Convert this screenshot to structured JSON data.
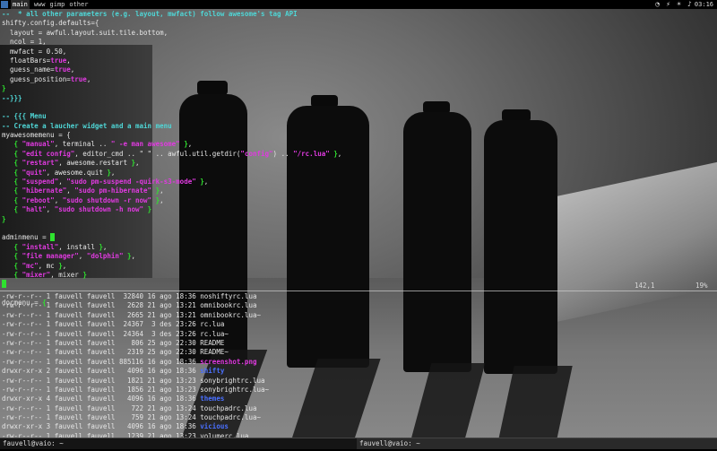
{
  "topbar": {
    "tags": [
      {
        "label": "main",
        "active": true
      },
      {
        "label": "www",
        "active": false
      },
      {
        "label": "gimp",
        "active": false
      },
      {
        "label": "other",
        "active": false
      }
    ],
    "tray_icons": [
      "wifi-icon",
      "power-icon",
      "brightness-icon",
      "volume-icon"
    ],
    "clock": "03:16"
  },
  "editor": {
    "lines": [
      [
        [
          "c-comment",
          "--  * all other parameters (e.g. layout, mwfact) follow awesome's tag API"
        ]
      ],
      [
        [
          "c-plain",
          "shifty.config.defaults={"
        ]
      ],
      [
        [
          "c-plain",
          "  layout = awful.layout.suit.tile.bottom,"
        ]
      ],
      [
        [
          "c-plain",
          "  ncol = 1,"
        ]
      ],
      [
        [
          "c-plain",
          "  mwfact = 0.50,"
        ]
      ],
      [
        [
          "c-plain",
          "  floatBars="
        ],
        [
          "c-bool",
          "true"
        ],
        [
          "c-plain",
          ","
        ]
      ],
      [
        [
          "c-plain",
          "  guess_name="
        ],
        [
          "c-bool",
          "true"
        ],
        [
          "c-plain",
          ","
        ]
      ],
      [
        [
          "c-plain",
          "  guess_position="
        ],
        [
          "c-bool",
          "true"
        ],
        [
          "c-plain",
          ","
        ]
      ],
      [
        [
          "c-brace",
          "}"
        ]
      ],
      [
        [
          "c-comment",
          "--}}}"
        ]
      ],
      [
        [
          "c-plain",
          ""
        ]
      ],
      [
        [
          "c-comment",
          "-- {{{ Menu"
        ]
      ],
      [
        [
          "c-comment",
          "-- Create a laucher widget and a main menu"
        ]
      ],
      [
        [
          "c-plain",
          "myawesomemenu = {"
        ]
      ],
      [
        [
          "c-plain",
          "   "
        ],
        [
          "c-brace",
          "{"
        ],
        [
          "c-str",
          " \"manual\""
        ],
        [
          "c-plain",
          ", terminal .. "
        ],
        [
          "c-str",
          "\" -e man awesome\""
        ],
        [
          "c-plain",
          " "
        ],
        [
          "c-brace",
          "}"
        ],
        [
          "c-plain",
          ","
        ]
      ],
      [
        [
          "c-plain",
          "   "
        ],
        [
          "c-brace",
          "{"
        ],
        [
          "c-str",
          " \"edit config\""
        ],
        [
          "c-plain",
          ", editor_cmd .. \" \" .. awful.util.getdir("
        ],
        [
          "c-str",
          "\"config\""
        ],
        [
          "c-plain",
          ") .. "
        ],
        [
          "c-str",
          "\"/rc.lua\""
        ],
        [
          "c-plain",
          " "
        ],
        [
          "c-brace",
          "}"
        ],
        [
          "c-plain",
          ","
        ]
      ],
      [
        [
          "c-plain",
          "   "
        ],
        [
          "c-brace",
          "{"
        ],
        [
          "c-str",
          " \"restart\""
        ],
        [
          "c-plain",
          ", awesome.restart "
        ],
        [
          "c-brace",
          "}"
        ],
        [
          "c-plain",
          ","
        ]
      ],
      [
        [
          "c-plain",
          "   "
        ],
        [
          "c-brace",
          "{"
        ],
        [
          "c-str",
          " \"quit\""
        ],
        [
          "c-plain",
          ", awesome.quit "
        ],
        [
          "c-brace",
          "}"
        ],
        [
          "c-plain",
          ","
        ]
      ],
      [
        [
          "c-plain",
          "   "
        ],
        [
          "c-brace",
          "{"
        ],
        [
          "c-str",
          " \"suspend\""
        ],
        [
          "c-plain",
          ", "
        ],
        [
          "c-str",
          "\"sudo pm-suspend -quirk-s3-mode\""
        ],
        [
          "c-plain",
          " "
        ],
        [
          "c-brace",
          "}"
        ],
        [
          "c-plain",
          ","
        ]
      ],
      [
        [
          "c-plain",
          "   "
        ],
        [
          "c-brace",
          "{"
        ],
        [
          "c-str",
          " \"hibernate\""
        ],
        [
          "c-plain",
          ", "
        ],
        [
          "c-str",
          "\"sudo pm-hibernate\""
        ],
        [
          "c-plain",
          " "
        ],
        [
          "c-brace",
          "}"
        ],
        [
          "c-plain",
          ","
        ]
      ],
      [
        [
          "c-plain",
          "   "
        ],
        [
          "c-brace",
          "{"
        ],
        [
          "c-str",
          " \"reboot\""
        ],
        [
          "c-plain",
          ", "
        ],
        [
          "c-str",
          "\"sudo shutdown -r now\""
        ],
        [
          "c-plain",
          " "
        ],
        [
          "c-brace",
          "}"
        ],
        [
          "c-plain",
          ","
        ]
      ],
      [
        [
          "c-plain",
          "   "
        ],
        [
          "c-brace",
          "{"
        ],
        [
          "c-str",
          " \"halt\""
        ],
        [
          "c-plain",
          ", "
        ],
        [
          "c-str",
          "\"sudo shutdown -h now\""
        ],
        [
          "c-plain",
          " "
        ],
        [
          "c-brace",
          "}"
        ]
      ],
      [
        [
          "c-brace",
          "}"
        ]
      ],
      [
        [
          "c-plain",
          ""
        ]
      ],
      [
        [
          "c-plain",
          "adminmenu = "
        ],
        [
          "c-cur",
          "{"
        ]
      ],
      [
        [
          "c-plain",
          "   "
        ],
        [
          "c-brace",
          "{"
        ],
        [
          "c-str",
          " \"install\""
        ],
        [
          "c-plain",
          ", install "
        ],
        [
          "c-brace",
          "}"
        ],
        [
          "c-plain",
          ","
        ]
      ],
      [
        [
          "c-plain",
          "   "
        ],
        [
          "c-brace",
          "{"
        ],
        [
          "c-str",
          " \"file manager\""
        ],
        [
          "c-plain",
          ", "
        ],
        [
          "c-str",
          "\"dolphin\""
        ],
        [
          "c-plain",
          " "
        ],
        [
          "c-brace",
          "}"
        ],
        [
          "c-plain",
          ","
        ]
      ],
      [
        [
          "c-plain",
          "   "
        ],
        [
          "c-brace",
          "{"
        ],
        [
          "c-str",
          " \"mc\""
        ],
        [
          "c-plain",
          ", mc "
        ],
        [
          "c-brace",
          "}"
        ],
        [
          "c-plain",
          ","
        ]
      ],
      [
        [
          "c-plain",
          "   "
        ],
        [
          "c-brace",
          "{"
        ],
        [
          "c-str",
          " \"mixer\""
        ],
        [
          "c-plain",
          ", mixer "
        ],
        [
          "c-brace",
          "}"
        ]
      ],
      [
        [
          "c-cur",
          "}"
        ]
      ],
      [
        [
          "c-plain",
          ""
        ]
      ],
      [
        [
          "c-plain",
          "docmenu = "
        ],
        [
          "c-brace",
          "{"
        ]
      ]
    ],
    "status_position": "142,1",
    "status_percent": "19%"
  },
  "listing": {
    "rows": [
      {
        "perm": "-rw-r--r--",
        "links": "1",
        "owner": "fauvell",
        "group": "fauvell",
        "size": "32840",
        "day": "16",
        "month": "ago",
        "time": "18:36",
        "name": "noshiftyrc.lua",
        "kind": "file"
      },
      {
        "perm": "-rw-r--r--",
        "links": "1",
        "owner": "fauvell",
        "group": "fauvell",
        "size": "2628",
        "day": "21",
        "month": "ago",
        "time": "13:21",
        "name": "omnibookrc.lua",
        "kind": "file"
      },
      {
        "perm": "-rw-r--r--",
        "links": "1",
        "owner": "fauvell",
        "group": "fauvell",
        "size": "2665",
        "day": "21",
        "month": "ago",
        "time": "13:21",
        "name": "omnibookrc.lua~",
        "kind": "file"
      },
      {
        "perm": "-rw-r--r--",
        "links": "1",
        "owner": "fauvell",
        "group": "fauvell",
        "size": "24367",
        "day": "3",
        "month": "des",
        "time": "23:26",
        "name": "rc.lua",
        "kind": "file"
      },
      {
        "perm": "-rw-r--r--",
        "links": "1",
        "owner": "fauvell",
        "group": "fauvell",
        "size": "24364",
        "day": "3",
        "month": "des",
        "time": "23:26",
        "name": "rc.lua~",
        "kind": "file"
      },
      {
        "perm": "-rw-r--r--",
        "links": "1",
        "owner": "fauvell",
        "group": "fauvell",
        "size": "806",
        "day": "25",
        "month": "ago",
        "time": "22:30",
        "name": "README",
        "kind": "file"
      },
      {
        "perm": "-rw-r--r--",
        "links": "1",
        "owner": "fauvell",
        "group": "fauvell",
        "size": "2319",
        "day": "25",
        "month": "ago",
        "time": "22:30",
        "name": "README~",
        "kind": "file"
      },
      {
        "perm": "-rw-r--r--",
        "links": "1",
        "owner": "fauvell",
        "group": "fauvell",
        "size": "885116",
        "day": "16",
        "month": "ago",
        "time": "18:36",
        "name": "screenshot.png",
        "kind": "img"
      },
      {
        "perm": "drwxr-xr-x",
        "links": "2",
        "owner": "fauvell",
        "group": "fauvell",
        "size": "4096",
        "day": "16",
        "month": "ago",
        "time": "18:36",
        "name": "shifty",
        "kind": "dir"
      },
      {
        "perm": "-rw-r--r--",
        "links": "1",
        "owner": "fauvell",
        "group": "fauvell",
        "size": "1821",
        "day": "21",
        "month": "ago",
        "time": "13:23",
        "name": "sonybrightrc.lua",
        "kind": "file"
      },
      {
        "perm": "-rw-r--r--",
        "links": "1",
        "owner": "fauvell",
        "group": "fauvell",
        "size": "1856",
        "day": "21",
        "month": "ago",
        "time": "13:23",
        "name": "sonybrightrc.lua~",
        "kind": "file"
      },
      {
        "perm": "drwxr-xr-x",
        "links": "4",
        "owner": "fauvell",
        "group": "fauvell",
        "size": "4096",
        "day": "16",
        "month": "ago",
        "time": "18:36",
        "name": "themes",
        "kind": "dir"
      },
      {
        "perm": "-rw-r--r--",
        "links": "1",
        "owner": "fauvell",
        "group": "fauvell",
        "size": "722",
        "day": "21",
        "month": "ago",
        "time": "13:24",
        "name": "touchpadrc.lua",
        "kind": "file"
      },
      {
        "perm": "-rw-r--r--",
        "links": "1",
        "owner": "fauvell",
        "group": "fauvell",
        "size": "759",
        "day": "21",
        "month": "ago",
        "time": "13:24",
        "name": "touchpadrc.lua~",
        "kind": "file"
      },
      {
        "perm": "drwxr-xr-x",
        "links": "3",
        "owner": "fauvell",
        "group": "fauvell",
        "size": "4096",
        "day": "16",
        "month": "ago",
        "time": "18:36",
        "name": "vicious",
        "kind": "dir"
      },
      {
        "perm": "-rw-r--r--",
        "links": "1",
        "owner": "fauvell",
        "group": "fauvell",
        "size": "1239",
        "day": "21",
        "month": "ago",
        "time": "13:23",
        "name": "volumerc.lua",
        "kind": "file"
      },
      {
        "perm": "-rw-r--r--",
        "links": "1",
        "owner": "fauvell",
        "group": "fauvell",
        "size": "1278",
        "day": "21",
        "month": "ago",
        "time": "13:23",
        "name": "volumerc.lua~",
        "kind": "file"
      }
    ]
  },
  "taskbar": {
    "tasks": [
      "fauvell@vaio: ~",
      "fauvell@vaio: ~"
    ],
    "active_index": 1
  }
}
